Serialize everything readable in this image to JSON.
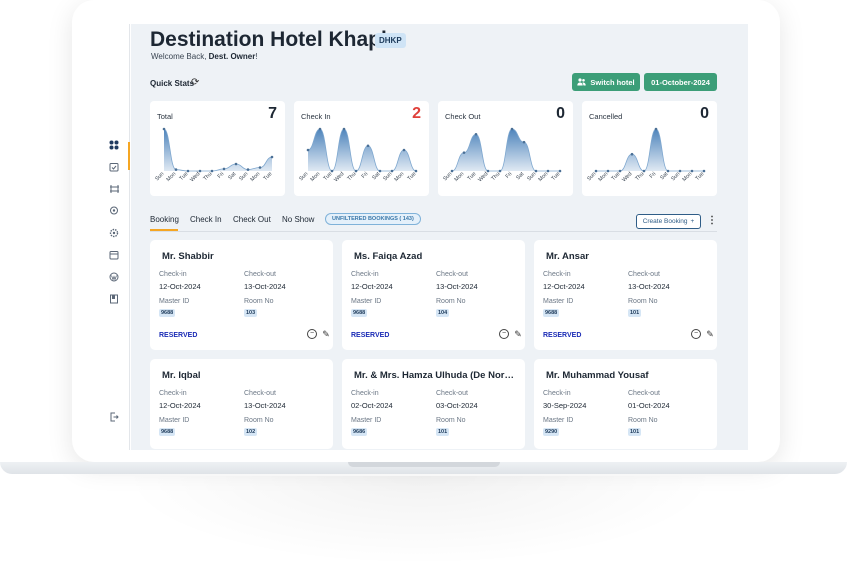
{
  "header": {
    "title": "Destination Hotel Khaplu",
    "code": "DHKP",
    "welcome_prefix": "Welcome Back, ",
    "welcome_user": "Dest. Owner",
    "welcome_suffix": "!"
  },
  "quick_stats": {
    "label": "Quick Stats",
    "switch_hotel": "Switch hotel",
    "date": "01-October-2024"
  },
  "stats": [
    {
      "label": "Total",
      "value": "7"
    },
    {
      "label": "Check In",
      "value": "2"
    },
    {
      "label": "Check Out",
      "value": "0"
    },
    {
      "label": "Cancelled",
      "value": "0"
    }
  ],
  "chart_data": [
    {
      "type": "line",
      "title": "Total",
      "x": [
        "Sun",
        "Mon",
        "Tue",
        "Wed",
        "Thu",
        "Fri",
        "Sat",
        "Sun",
        "Mon",
        "Tue"
      ],
      "values": [
        6,
        0.2,
        0,
        0,
        0,
        0.3,
        1,
        0.2,
        0.5,
        2
      ]
    },
    {
      "type": "area",
      "title": "Check In",
      "x": [
        "Sun",
        "Mon",
        "Tue",
        "Wed",
        "Thu",
        "Fri",
        "Sat",
        "Sun",
        "Mon",
        "Tue"
      ],
      "values": [
        1,
        2,
        0,
        2,
        0,
        1.2,
        0,
        0,
        1,
        0
      ]
    },
    {
      "type": "area",
      "title": "Check Out",
      "x": [
        "Sun",
        "Mon",
        "Tue",
        "Wed",
        "Thu",
        "Fri",
        "Sat",
        "Sun",
        "Mon",
        "Tue"
      ],
      "values": [
        0,
        0.7,
        1.4,
        0,
        0,
        1.6,
        1.1,
        0,
        0,
        0
      ]
    },
    {
      "type": "area",
      "title": "Cancelled",
      "x": [
        "Sun",
        "Mon",
        "Tue",
        "Wed",
        "Thu",
        "Fri",
        "Sat",
        "Sun",
        "Mon",
        "Tue"
      ],
      "values": [
        0,
        0,
        0,
        1,
        0,
        2.5,
        0,
        0,
        0,
        0
      ]
    }
  ],
  "tabs": {
    "items": [
      "Booking",
      "Check In",
      "Check Out",
      "No Show"
    ],
    "unfiltered": "UNFILTERED BOOKINGS ( 143)",
    "create_booking": "Create Booking"
  },
  "labels": {
    "check_in": "Check-in",
    "check_out": "Check-out",
    "master_id": "Master ID",
    "room_no": "Room No"
  },
  "bookings": [
    {
      "name": "Mr. Shabbir",
      "check_in": "12-Oct-2024",
      "check_out": "13-Oct-2024",
      "master_id": "9688",
      "room": "103",
      "status": "RESERVED"
    },
    {
      "name": "Ms. Faiqa Azad",
      "check_in": "12-Oct-2024",
      "check_out": "13-Oct-2024",
      "master_id": "9688",
      "room": "104",
      "status": "RESERVED"
    },
    {
      "name": "Mr. Ansar",
      "check_in": "12-Oct-2024",
      "check_out": "13-Oct-2024",
      "master_id": "9688",
      "room": "101",
      "status": "RESERVED"
    },
    {
      "name": "Mr. Iqbal",
      "check_in": "12-Oct-2024",
      "check_out": "13-Oct-2024",
      "master_id": "9688",
      "room": "102",
      "status": ""
    },
    {
      "name": "Mr. & Mrs. Hamza Ulhuda (De North...",
      "check_in": "02-Oct-2024",
      "check_out": "03-Oct-2024",
      "master_id": "9686",
      "room": "101",
      "status": ""
    },
    {
      "name": "Mr. Muhammad Yousaf",
      "check_in": "30-Sep-2024",
      "check_out": "01-Oct-2024",
      "master_id": "9290",
      "room": "101",
      "status": ""
    }
  ],
  "colors": {
    "accent": "#f5a623",
    "primary": "#3c9e78",
    "chart_fill": "#2f6fb0",
    "status_reserved": "#1a2bb5",
    "alert_red": "#e0403a"
  },
  "sidebar_icons": [
    "grid-icon",
    "calendar-check-icon",
    "transfer-icon",
    "badge-icon",
    "settings-icon",
    "calendar-icon",
    "wordpress-icon",
    "book-icon",
    "logout-icon"
  ]
}
